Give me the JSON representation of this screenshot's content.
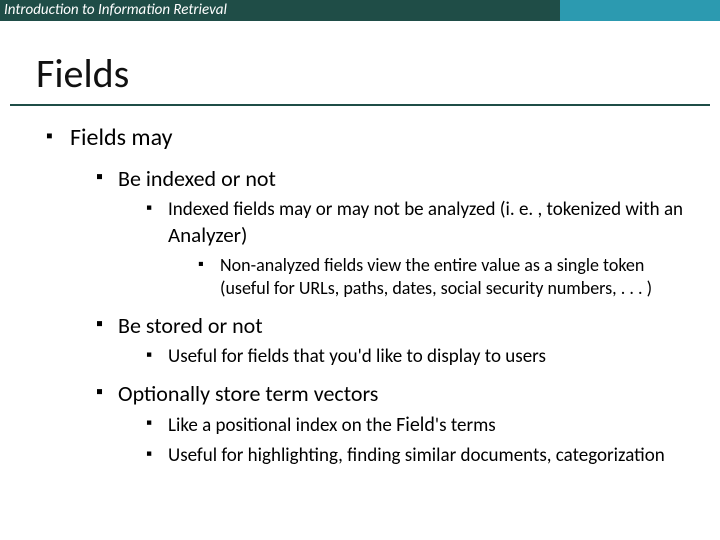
{
  "header": {
    "course": "Introduction to Information Retrieval"
  },
  "title": "Fields",
  "bullets": {
    "b1": "Fields may",
    "b1_1": "Be indexed or not",
    "b1_1_1_a": "Indexed fields may or may not be analyzed (i. e. , tokenized with an ",
    "b1_1_1_b": "Analyzer)",
    "b1_1_1_1": "Non-analyzed fields view the entire value as a single token (useful for URLs, paths, dates, social security numbers, . . . )",
    "b1_2": "Be stored or not",
    "b1_2_1": "Useful for fields that you'd like to display to users",
    "b1_3": "Optionally store term vectors",
    "b1_3_1_a": "Like a positional index on the ",
    "b1_3_1_b": "Field",
    "b1_3_1_c": "'s terms",
    "b1_3_2": "Useful for highlighting, finding similar documents, categorization"
  }
}
